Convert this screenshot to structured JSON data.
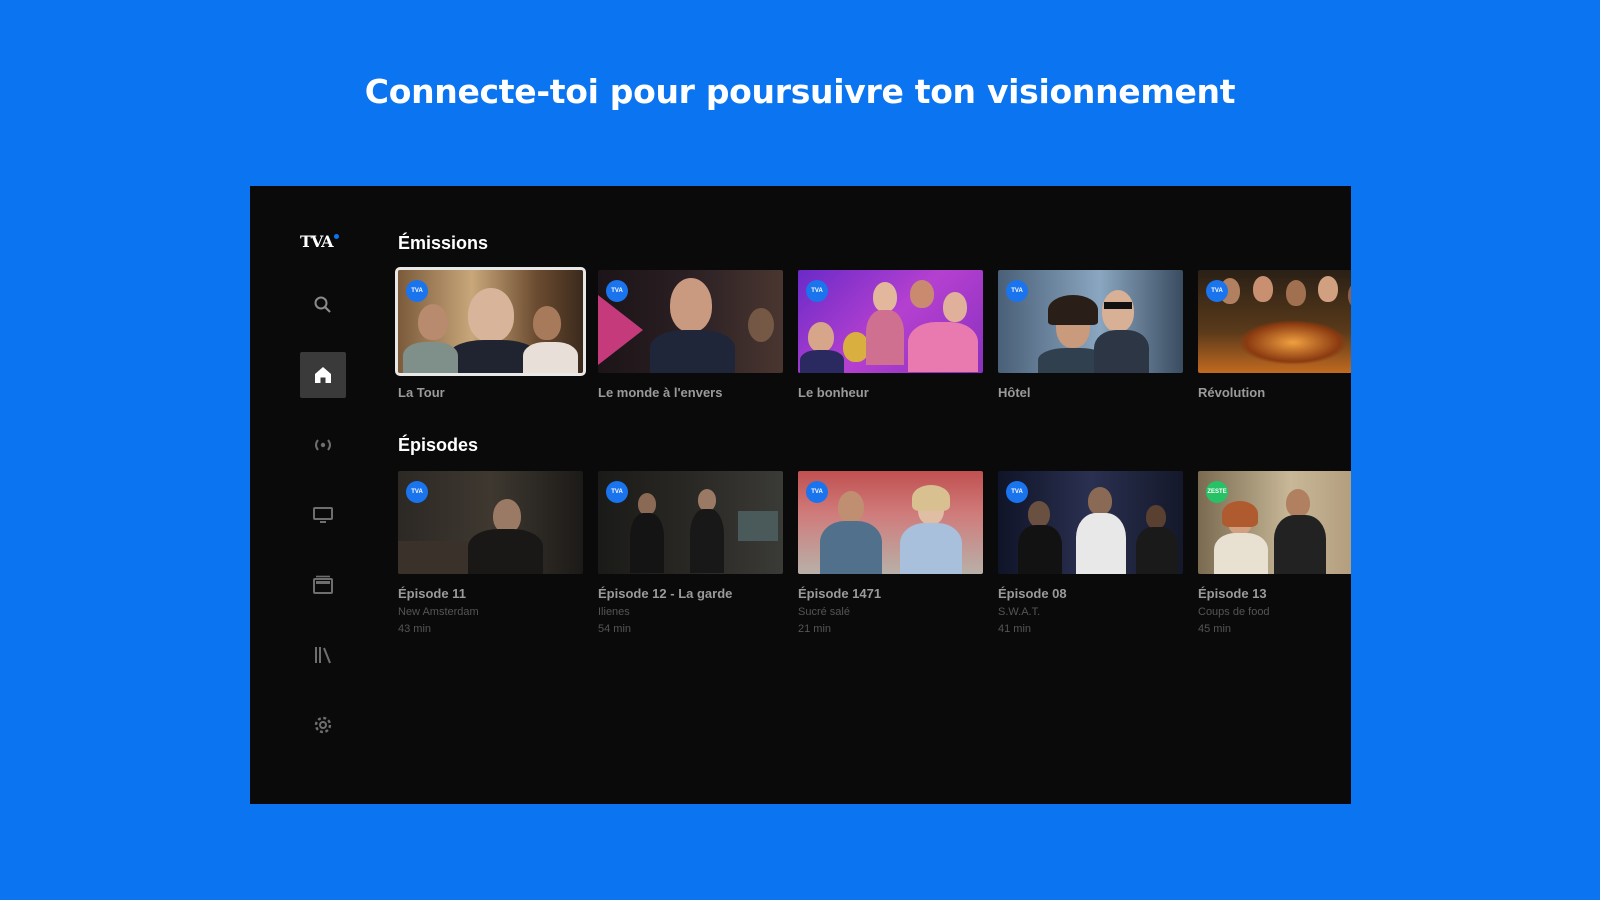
{
  "headline": "Connecte-toi pour poursuivre ton visionnement",
  "logo": "TVA",
  "nav": [
    {
      "name": "search-icon"
    },
    {
      "name": "home-icon"
    },
    {
      "name": "live-icon"
    },
    {
      "name": "tv-icon"
    },
    {
      "name": "video-library-icon"
    },
    {
      "name": "library-icon"
    },
    {
      "name": "gear-icon"
    }
  ],
  "emissions": {
    "title": "Émissions",
    "items": [
      {
        "title": "La Tour",
        "badge": "TVA"
      },
      {
        "title": "Le monde à l'envers",
        "badge": "TVA"
      },
      {
        "title": "Le bonheur",
        "badge": "TVA"
      },
      {
        "title": "Hôtel",
        "badge": "TVA"
      },
      {
        "title": "Révolution",
        "badge": "TVA"
      }
    ]
  },
  "episodes": {
    "title": "Épisodes",
    "items": [
      {
        "title": "Épisode 11",
        "show": "New Amsterdam",
        "duration": "43 min",
        "badge": "TVA"
      },
      {
        "title": "Épisode 12 - La garde",
        "show": "Ilienes",
        "duration": "54 min",
        "badge": "TVA"
      },
      {
        "title": "Épisode 1471",
        "show": "Sucré salé",
        "duration": "21 min",
        "badge": "TVA"
      },
      {
        "title": "Épisode 08",
        "show": "S.W.A.T.",
        "duration": "41 min",
        "badge": "TVA"
      },
      {
        "title": "Épisode 13",
        "show": "Coups de food",
        "duration": "45 min",
        "badge": "ZESTE"
      }
    ]
  },
  "colors": {
    "accent": "#0b74f0",
    "screen": "#0a0a0a",
    "badge": "#1a74ee",
    "badge_green": "#27c266"
  }
}
